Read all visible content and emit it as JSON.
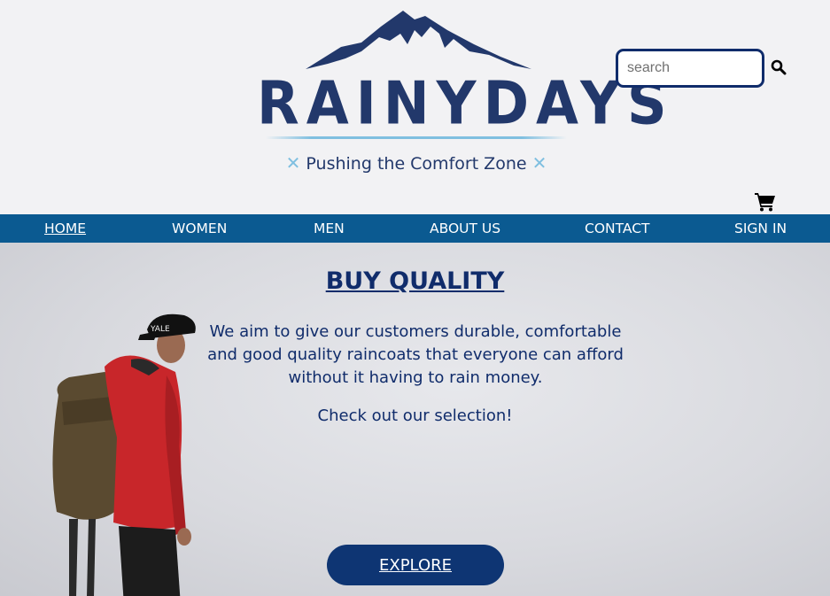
{
  "header": {
    "logo_text": "RAINYDAYS",
    "tagline": "Pushing the Comfort Zone",
    "search": {
      "placeholder": "search",
      "value": ""
    }
  },
  "nav": {
    "items": [
      {
        "label": "HOME",
        "active": true
      },
      {
        "label": "WOMEN"
      },
      {
        "label": "MEN"
      },
      {
        "label": "ABOUT US"
      },
      {
        "label": "CONTACT"
      },
      {
        "label": "SIGN IN"
      }
    ]
  },
  "hero": {
    "title": "BUY QUALITY",
    "text": "We aim to give our customers durable, comfortable and good quality raincoats that everyone can afford without it having to rain money.",
    "sub": "Check out our selection!",
    "button_label": "EXPLORE",
    "cap_text": "YALE"
  },
  "icons": {
    "search": "search-icon",
    "cart": "shopping-cart-icon",
    "logo": "mountain-logo-icon"
  },
  "colors": {
    "brand_navy": "#22386b",
    "nav_blue": "#0b5a91",
    "button_navy": "#0e3573",
    "accent_light_blue": "#7fbfe0"
  }
}
